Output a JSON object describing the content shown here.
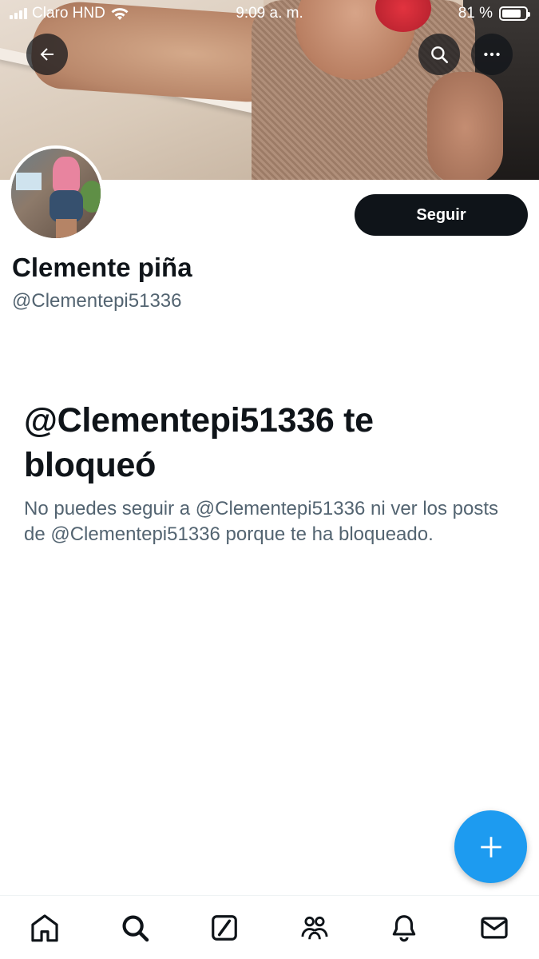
{
  "status_bar": {
    "carrier": "Claro HND",
    "time": "9:09 a. m.",
    "battery": "81 %",
    "battery_level": 0.81
  },
  "profile": {
    "display_name": "Clemente piña",
    "handle": "@Clementepi51336",
    "follow_label": "Seguir"
  },
  "blocked": {
    "title": "@Clementepi51336 te bloqueó",
    "message": "No puedes seguir a @Clementepi51336 ni ver los posts de @Clementepi51336 porque te ha bloqueado."
  },
  "top_actions": {
    "back_icon": "arrow-left-icon",
    "search_icon": "search-icon",
    "more_icon": "more-horizontal-icon"
  },
  "fab": {
    "icon": "plus-icon"
  },
  "bottom_nav": [
    {
      "name": "home",
      "icon": "home-icon"
    },
    {
      "name": "search",
      "icon": "search-icon"
    },
    {
      "name": "grok",
      "icon": "grok-icon"
    },
    {
      "name": "communities",
      "icon": "people-icon"
    },
    {
      "name": "notifications",
      "icon": "bell-icon"
    },
    {
      "name": "messages",
      "icon": "mail-icon"
    }
  ],
  "colors": {
    "accent": "#1d9bf0",
    "primary_text": "#0f1419",
    "secondary_text": "#536471",
    "button_dark": "#0f1419"
  }
}
